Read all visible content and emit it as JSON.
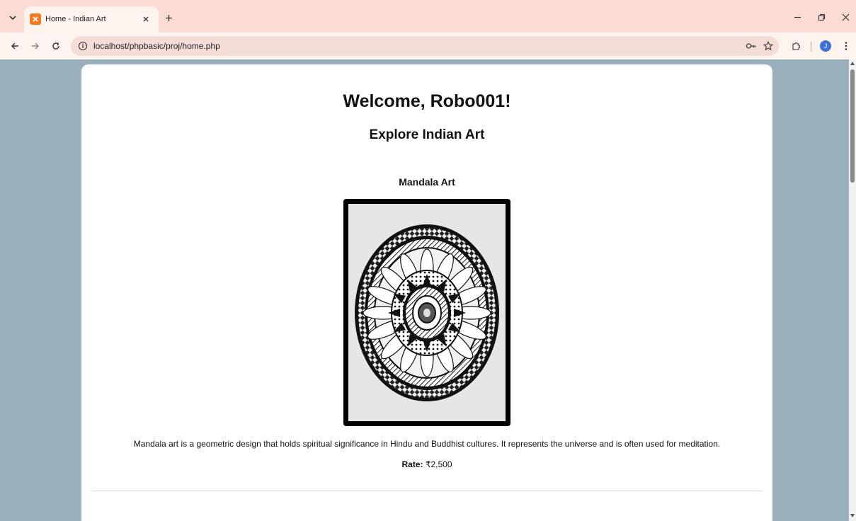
{
  "browser": {
    "tab": {
      "title": "Home - Indian Art"
    },
    "address": {
      "url": "localhost/phpbasic/proj/home.php"
    },
    "profile_initial": "J",
    "icons": {
      "tab_list": "chevron-down-icon",
      "favicon": "xampp-favicon",
      "tab_close": "close-icon",
      "new_tab": "plus-icon",
      "back": "arrow-left-icon",
      "forward": "arrow-right-icon",
      "reload": "reload-icon",
      "site_info": "info-icon",
      "password": "key-icon",
      "bookmark": "star-icon",
      "extensions": "puzzle-icon",
      "menu": "kebab-menu-icon",
      "minimize": "minimize-icon",
      "restore": "restore-icon",
      "close_window": "close-icon"
    }
  },
  "page": {
    "welcome": "Welcome, Robo001!",
    "subtitle": "Explore Indian Art",
    "artwork": {
      "title": "Mandala Art",
      "description": "Mandala art is a geometric design that holds spiritual significance in Hindu and Buddhist cultures. It represents the universe and is often used for meditation.",
      "rate_label": "Rate:",
      "rate_value": "₹2,500"
    }
  },
  "colors": {
    "tabstrip": "#fbdcd3",
    "toolbar": "#fdf3ef",
    "page_background": "#9aafbc",
    "card": "#ffffff",
    "accent_profile": "#3f6fd8"
  }
}
